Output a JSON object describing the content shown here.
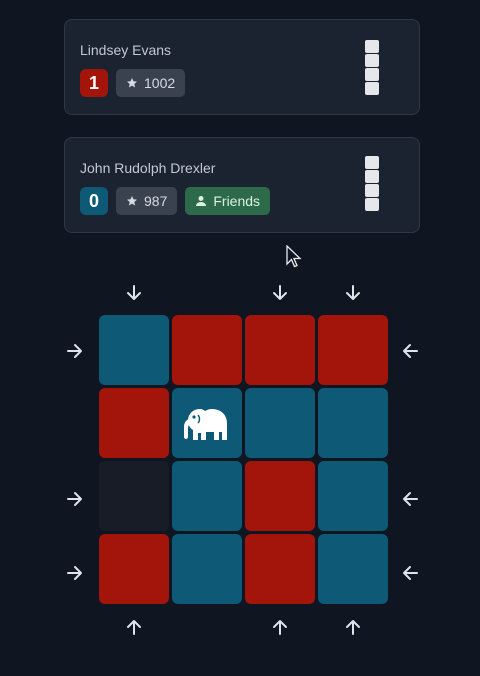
{
  "players": [
    {
      "name": "Lindsey Evans",
      "score": "1",
      "score_color": "#a3150b",
      "rating": "1002",
      "friends": null,
      "stack_count": 4
    },
    {
      "name": "John Rudolph Drexler",
      "score": "0",
      "score_color": "#0e5a76",
      "rating": "987",
      "friends": "Friends",
      "stack_count": 4
    }
  ],
  "colors": {
    "red": "#a3150b",
    "blue": "#0e5a76",
    "empty": "#171c27",
    "background": "#0f1521"
  },
  "board": [
    [
      "blue",
      "red",
      "red",
      "red"
    ],
    [
      "red",
      "blue-elephant",
      "blue",
      "blue"
    ],
    [
      "empty",
      "blue",
      "red",
      "blue"
    ],
    [
      "red",
      "blue",
      "red",
      "blue"
    ]
  ],
  "arrows": {
    "top": [
      "arrow-down-icon",
      "arrow-down-icon",
      "arrow-down-icon"
    ],
    "left": [
      "arrow-right-icon",
      "arrow-right-icon",
      "arrow-right-icon"
    ],
    "right": [
      "arrow-left-icon",
      "arrow-left-icon",
      "arrow-left-icon"
    ],
    "bottom": [
      "arrow-up-icon",
      "arrow-up-icon",
      "arrow-up-icon"
    ]
  }
}
